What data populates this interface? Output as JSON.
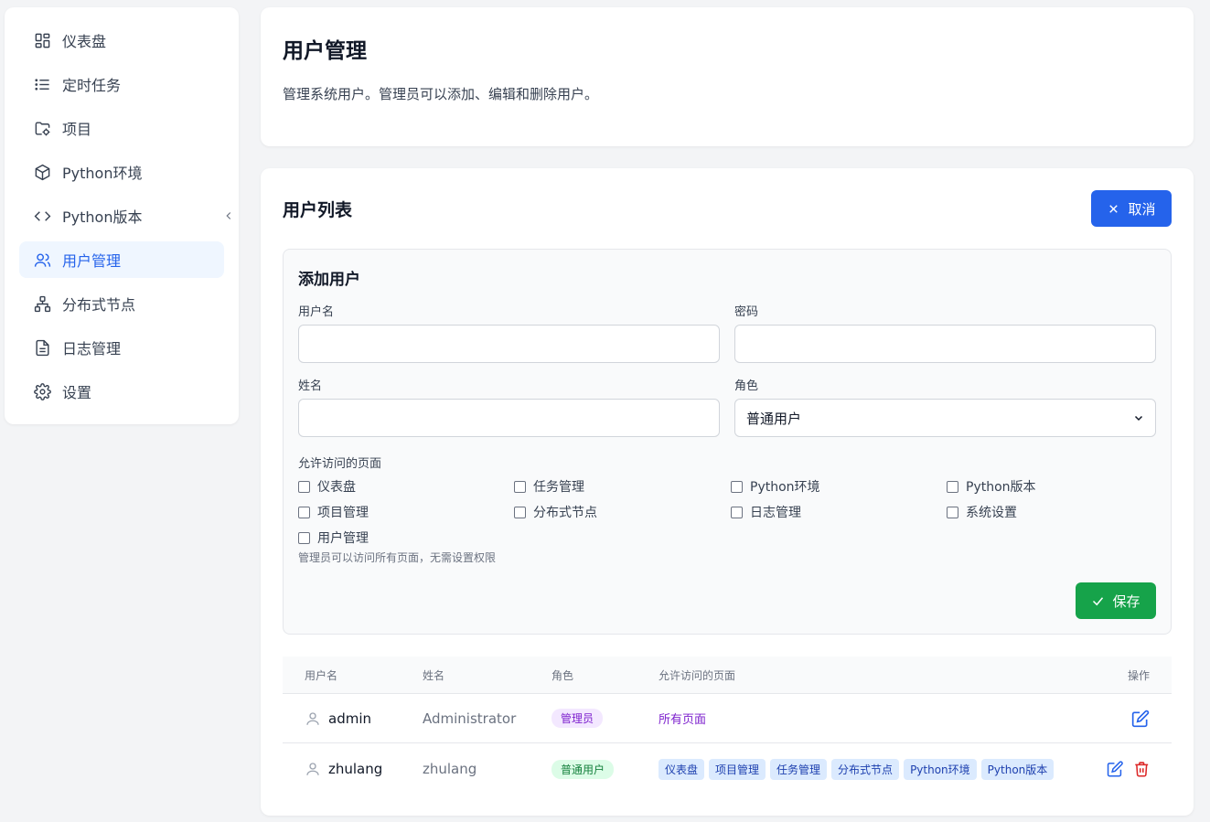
{
  "sidebar": {
    "items": [
      {
        "label": "仪表盘",
        "icon": "dashboard-icon"
      },
      {
        "label": "定时任务",
        "icon": "list-icon"
      },
      {
        "label": "项目",
        "icon": "folder-icon"
      },
      {
        "label": "Python环境",
        "icon": "package-icon"
      },
      {
        "label": "Python版本",
        "icon": "code-icon"
      },
      {
        "label": "用户管理",
        "icon": "users-icon",
        "active": true
      },
      {
        "label": "分布式节点",
        "icon": "network-icon"
      },
      {
        "label": "日志管理",
        "icon": "file-text-icon"
      },
      {
        "label": "设置",
        "icon": "gear-icon"
      }
    ]
  },
  "header": {
    "title": "用户管理",
    "description": "管理系统用户。管理员可以添加、编辑和删除用户。"
  },
  "user_list": {
    "title": "用户列表",
    "cancel_label": "取消"
  },
  "form": {
    "title": "添加用户",
    "username_label": "用户名",
    "password_label": "密码",
    "name_label": "姓名",
    "role_label": "角色",
    "role_value": "普通用户",
    "perm_title": "允许访问的页面",
    "permissions": [
      "仪表盘",
      "任务管理",
      "Python环境",
      "Python版本",
      "项目管理",
      "分布式节点",
      "日志管理",
      "系统设置",
      "用户管理"
    ],
    "perm_hint": "管理员可以访问所有页面，无需设置权限",
    "save_label": "保存"
  },
  "table": {
    "headers": [
      "用户名",
      "姓名",
      "角色",
      "允许访问的页面",
      "操作"
    ],
    "rows": [
      {
        "username": "admin",
        "name": "Administrator",
        "role": "管理员",
        "pages_text": "所有页面",
        "pages": []
      },
      {
        "username": "zhulang",
        "name": "zhulang",
        "role": "普通用户",
        "pages_text": "",
        "pages": [
          "仪表盘",
          "项目管理",
          "任务管理",
          "分布式节点",
          "Python环境",
          "Python版本"
        ]
      }
    ]
  },
  "colors": {
    "primary": "#2563eb",
    "success": "#16a34a",
    "danger": "#dc2626",
    "admin_badge": "#7e22ce",
    "user_badge": "#15803d"
  }
}
